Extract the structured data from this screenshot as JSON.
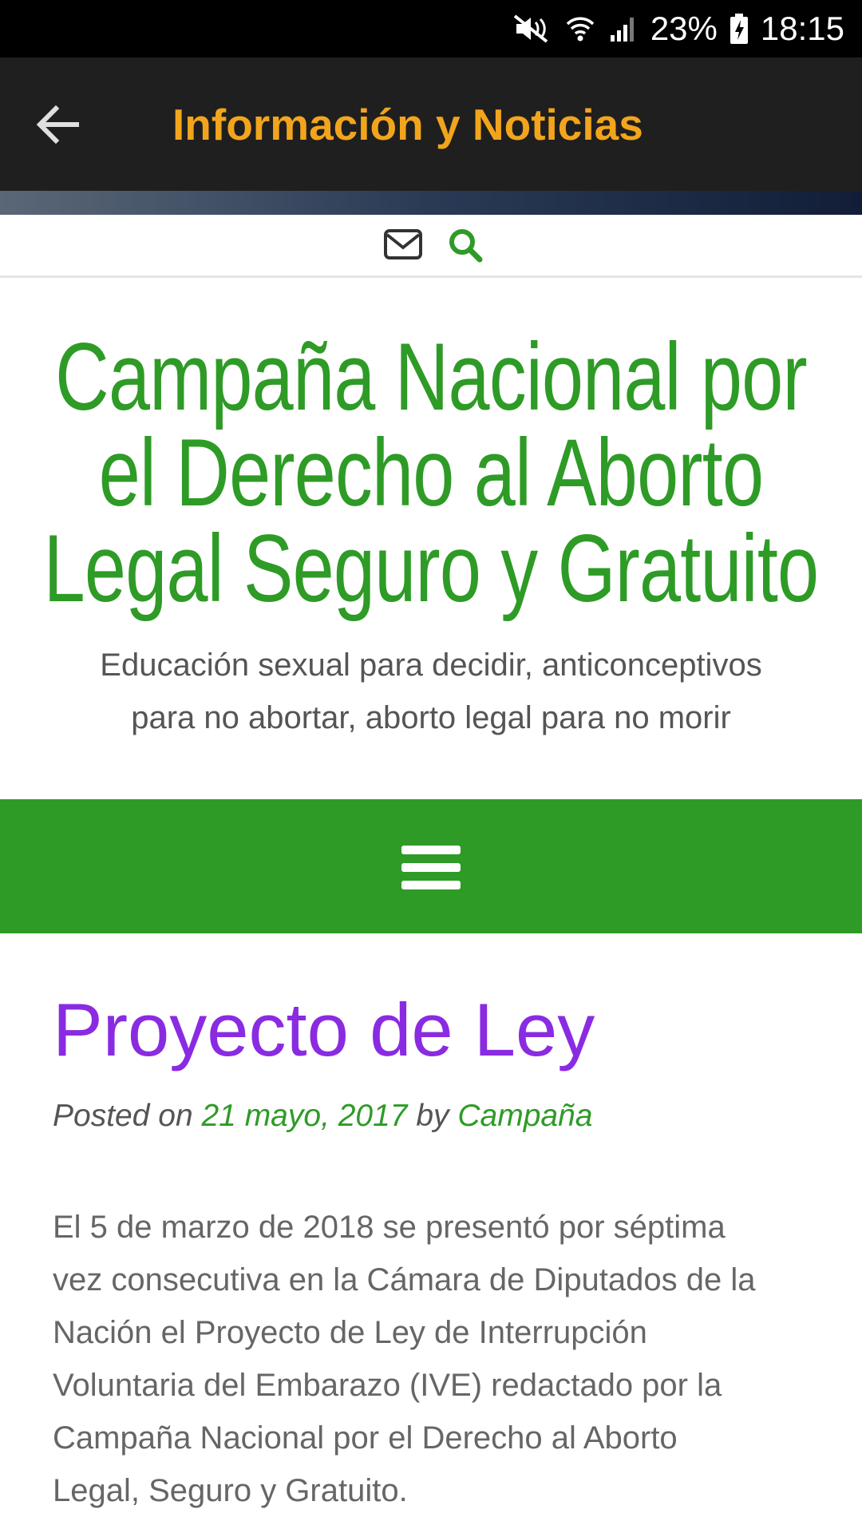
{
  "status_bar": {
    "battery": "23%",
    "time": "18:15",
    "icons": [
      "mute-icon",
      "wifi-icon",
      "signal-icon",
      "battery-charging-icon"
    ]
  },
  "app_bar": {
    "title": "Información y Noticias",
    "back_icon": "arrow-left-icon",
    "title_color": "#f2a51c"
  },
  "header_icons": [
    "envelope-icon",
    "search-icon"
  ],
  "site": {
    "title_lines": [
      "Campaña Nacional por",
      "el Derecho al Aborto",
      "Legal Seguro y Gratuito"
    ],
    "tagline_lines": [
      "Educación sexual para decidir, anticonceptivos",
      "para no abortar, aborto legal para no morir"
    ],
    "brand_color": "#2e9b26"
  },
  "nav": {
    "menu_icon": "hamburger-menu-icon"
  },
  "post": {
    "title": "Proyecto de Ley",
    "title_color": "#8a2be2",
    "meta_posted_on": "Posted on",
    "meta_date": "21 mayo, 2017",
    "meta_by": "by",
    "meta_author": "Campaña",
    "body_lines": [
      "El 5 de marzo de 2018 se presentó por séptima",
      "vez consecutiva en la Cámara de Diputados de la",
      "Nación el Proyecto de Ley de Interrupción",
      "Voluntaria del Embarazo (IVE) redactado por la",
      "Campaña Nacional por el Derecho al Aborto",
      "Legal, Seguro y Gratuito."
    ]
  }
}
